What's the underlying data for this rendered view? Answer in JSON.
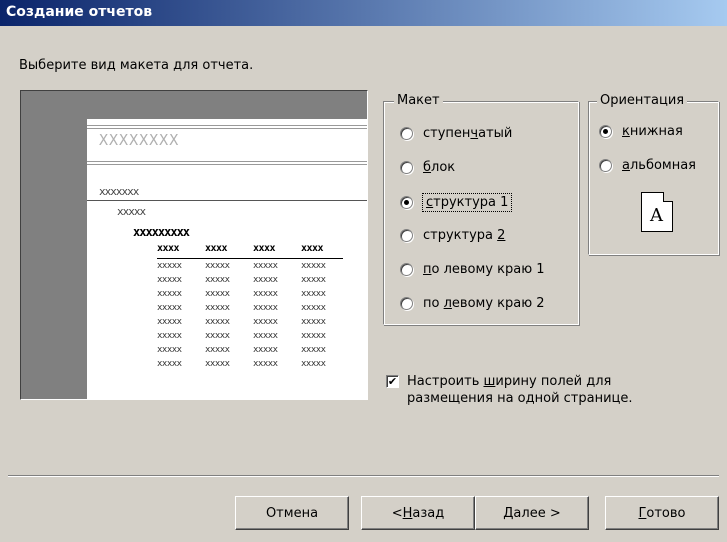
{
  "window": {
    "title": "Создание отчетов"
  },
  "prompt": "Выберите вид макета для отчета.",
  "preview": {
    "title_placeholder": "XXXXXXXX",
    "group1": "xxxxxxx",
    "group2": "xxxxx",
    "group3": "xxxxxxxxx",
    "header_row": [
      "xxxx",
      "xxxx",
      "xxxx",
      "xxxx"
    ],
    "data_rows": [
      [
        "xxxxx",
        "xxxxx",
        "xxxxx",
        "xxxxx"
      ],
      [
        "xxxxx",
        "xxxxx",
        "xxxxx",
        "xxxxx"
      ],
      [
        "xxxxx",
        "xxxxx",
        "xxxxx",
        "xxxxx"
      ],
      [
        "xxxxx",
        "xxxxx",
        "xxxxx",
        "xxxxx"
      ],
      [
        "xxxxx",
        "xxxxx",
        "xxxxx",
        "xxxxx"
      ],
      [
        "xxxxx",
        "xxxxx",
        "xxxxx",
        "xxxxx"
      ],
      [
        "xxxxx",
        "xxxxx",
        "xxxxx",
        "xxxxx"
      ],
      [
        "xxxxx",
        "xxxxx",
        "xxxxx",
        "xxxxx"
      ]
    ]
  },
  "layout_group": {
    "legend": "Макет",
    "options": [
      {
        "pre": "ступен",
        "mn": "ч",
        "post": "атый",
        "selected": false
      },
      {
        "pre": "",
        "mn": "б",
        "post": "лок",
        "selected": false
      },
      {
        "pre": "",
        "mn": "с",
        "post": "труктура 1",
        "selected": true
      },
      {
        "pre": "структура ",
        "mn": "2",
        "post": "",
        "selected": false
      },
      {
        "pre": "",
        "mn": "п",
        "post": "о левому краю 1",
        "selected": false
      },
      {
        "pre": "по ",
        "mn": "л",
        "post": "евому краю 2",
        "selected": false
      }
    ]
  },
  "orientation_group": {
    "legend": "Ориентация",
    "options": [
      {
        "pre": "",
        "mn": "к",
        "post": "нижная",
        "selected": true
      },
      {
        "pre": "",
        "mn": "а",
        "post": "льбомная",
        "selected": false
      }
    ],
    "icon_letter": "A"
  },
  "fit_width": {
    "checked": true,
    "label_pre": "Настроить ",
    "label_mn": "ш",
    "label_post": "ирину полей для размещения на одной странице."
  },
  "buttons": {
    "cancel": "Отмена",
    "back": {
      "pre": "< ",
      "mn": "Н",
      "post": "азад"
    },
    "next": {
      "pre": "",
      "mn": "Д",
      "post": "алее >"
    },
    "finish": {
      "pre": "",
      "mn": "Г",
      "post": "отово"
    }
  }
}
